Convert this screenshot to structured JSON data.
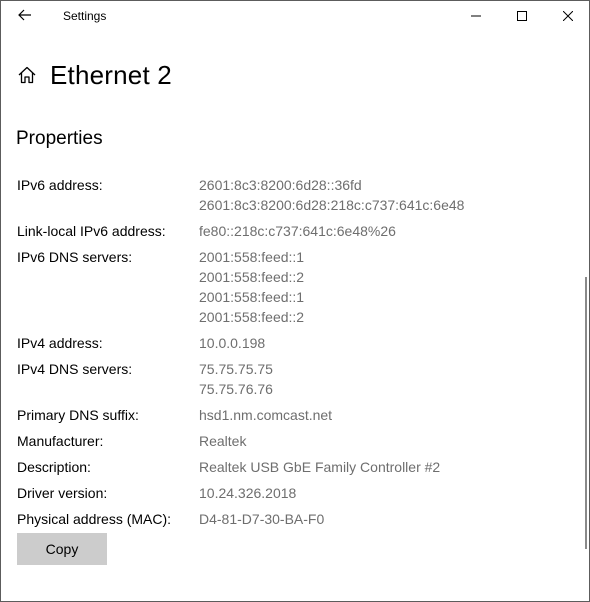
{
  "window": {
    "title": "Settings"
  },
  "header": {
    "title": "Ethernet 2"
  },
  "section": {
    "title": "Properties"
  },
  "properties": [
    {
      "label": "IPv6 address:",
      "values": [
        "2601:8c3:8200:6d28::36fd",
        "2601:8c3:8200:6d28:218c:c737:641c:6e48"
      ]
    },
    {
      "label": "Link-local IPv6 address:",
      "values": [
        "fe80::218c:c737:641c:6e48%26"
      ]
    },
    {
      "label": "IPv6 DNS servers:",
      "values": [
        "2001:558:feed::1",
        "2001:558:feed::2",
        "2001:558:feed::1",
        "2001:558:feed::2"
      ]
    },
    {
      "label": "IPv4 address:",
      "values": [
        "10.0.0.198"
      ]
    },
    {
      "label": "IPv4 DNS servers:",
      "values": [
        "75.75.75.75",
        "75.75.76.76"
      ]
    },
    {
      "label": "Primary DNS suffix:",
      "values": [
        "hsd1.nm.comcast.net"
      ]
    },
    {
      "label": "Manufacturer:",
      "values": [
        "Realtek"
      ]
    },
    {
      "label": "Description:",
      "values": [
        "Realtek USB GbE Family Controller #2"
      ]
    },
    {
      "label": "Driver version:",
      "values": [
        "10.24.326.2018"
      ]
    },
    {
      "label": "Physical address (MAC):",
      "values": [
        "D4-81-D7-30-BA-F0"
      ]
    }
  ],
  "actions": {
    "copy_label": "Copy"
  },
  "icons": {
    "back": "back-arrow-icon",
    "minimize": "minimize-icon",
    "maximize": "maximize-icon",
    "close": "close-icon",
    "home": "home-icon"
  },
  "colors": {
    "value_text": "#6e6e6e",
    "button_bg": "#cccccc",
    "scrollbar": "#8a8a8a"
  }
}
